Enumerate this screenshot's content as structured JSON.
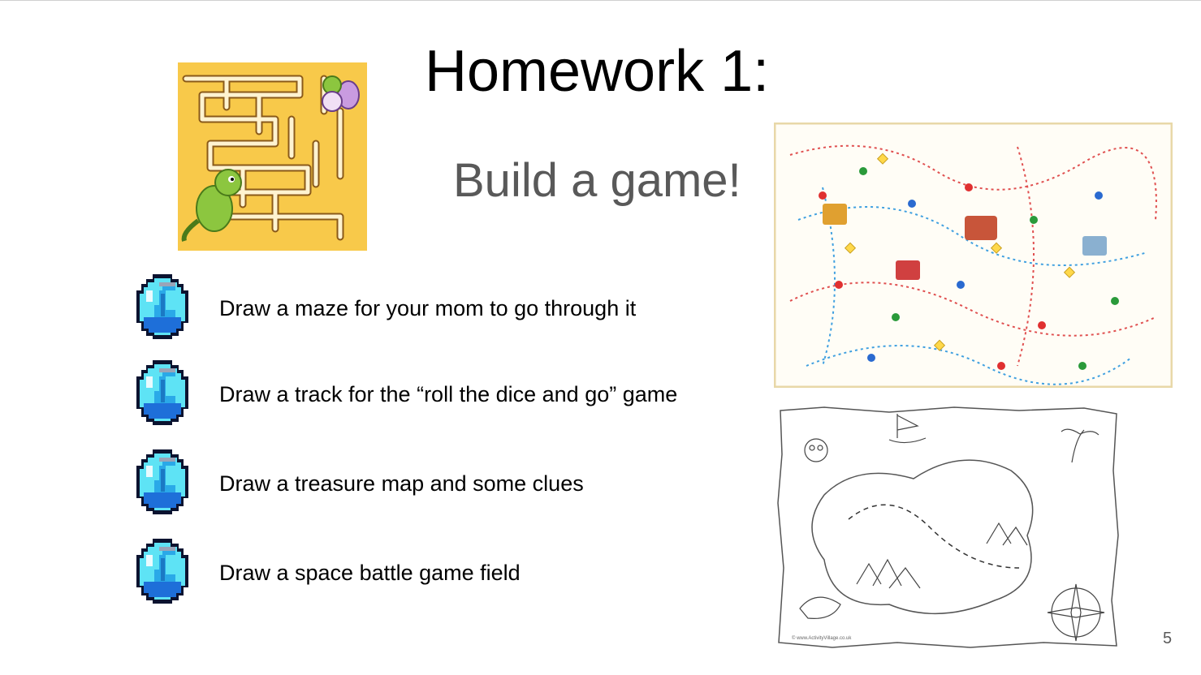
{
  "slide": {
    "title": "Homework 1:",
    "subtitle": "Build a game!",
    "slide_number": "5"
  },
  "items": [
    {
      "label": "Draw a maze for your mom to go through it",
      "icon": "potion-icon"
    },
    {
      "label": "Draw a track for the “roll the dice and go” game",
      "icon": "potion-icon"
    },
    {
      "label": "Draw a treasure map and some clues",
      "icon": "potion-icon"
    },
    {
      "label": "Draw a space battle game field",
      "icon": "potion-icon"
    }
  ],
  "images": {
    "maze": {
      "description_icon": "maze-dinosaur-image"
    },
    "board_game": {
      "description_icon": "board-game-image"
    },
    "treasure_map": {
      "description_icon": "treasure-map-image"
    }
  },
  "colors": {
    "title": "#000000",
    "subtitle": "#595959",
    "maze_bg": "#f8c94a",
    "potion_light": "#5ee3f5",
    "potion_dark": "#1e6fd9"
  }
}
